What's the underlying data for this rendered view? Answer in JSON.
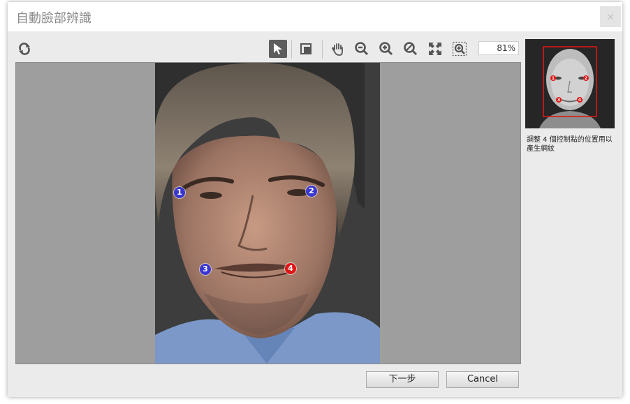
{
  "window": {
    "title": "自動臉部辨識",
    "close_label": "×"
  },
  "toolbar": {
    "tools": [
      {
        "name": "rotate-icon"
      },
      {
        "name": "select-arrow-icon",
        "active": true
      },
      {
        "name": "crop-icon"
      },
      {
        "name": "pan-hand-icon"
      },
      {
        "name": "zoom-out-icon"
      },
      {
        "name": "zoom-in-icon"
      },
      {
        "name": "zoom-reset-icon"
      },
      {
        "name": "fit-screen-icon"
      },
      {
        "name": "zoom-selection-icon"
      }
    ],
    "zoom_value": "81%"
  },
  "canvas": {
    "background_color": "#9e9e9e",
    "control_points": [
      {
        "label": "1",
        "color": "#3a37d0"
      },
      {
        "label": "2",
        "color": "#3a37d0"
      },
      {
        "label": "3",
        "color": "#3a37d0"
      },
      {
        "label": "4",
        "color": "#e01616"
      }
    ]
  },
  "sidebar": {
    "thumbnail_points": [
      "1",
      "2",
      "3",
      "4"
    ],
    "hint": "調整 4 個控制點的位置用以產生網紋"
  },
  "buttons": {
    "next_label": "下一步",
    "cancel_label": "Cancel"
  }
}
